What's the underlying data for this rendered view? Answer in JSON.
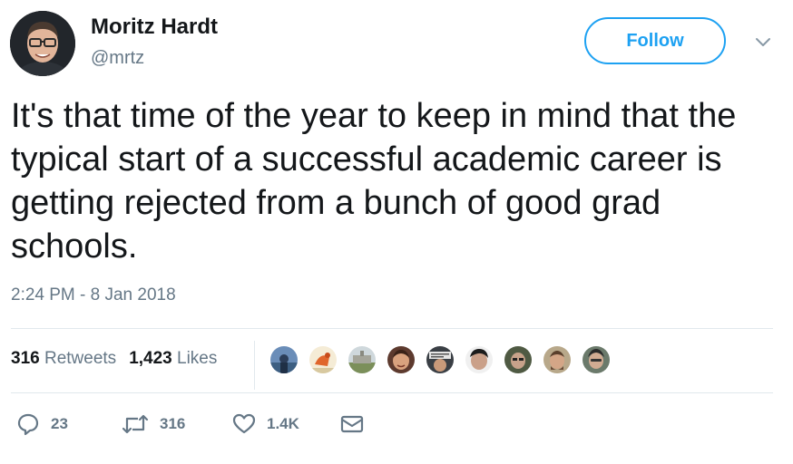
{
  "author": {
    "name": "Moritz Hardt",
    "handle": "@mrtz"
  },
  "follow_label": "Follow",
  "tweet": {
    "text": "It's that time of the year to keep in mind that the typical start of a successful academic career is getting rejected from a bunch of good grad schools.",
    "timestamp": "2:24 PM - 8 Jan 2018"
  },
  "stats": {
    "retweets_count": "316",
    "retweets_label": "Retweets",
    "likes_count": "1,423",
    "likes_label": "Likes"
  },
  "actions": {
    "replies": "23",
    "retweets": "316",
    "likes": "1.4K"
  },
  "likers": [
    "liker-avatar-1",
    "liker-avatar-2",
    "liker-avatar-3",
    "liker-avatar-4",
    "liker-avatar-5",
    "liker-avatar-6",
    "liker-avatar-7",
    "liker-avatar-8",
    "liker-avatar-9"
  ],
  "colors": {
    "accent": "#1da1f2",
    "text": "#14171a",
    "muted": "#657786",
    "divider": "#e1e8ed"
  }
}
